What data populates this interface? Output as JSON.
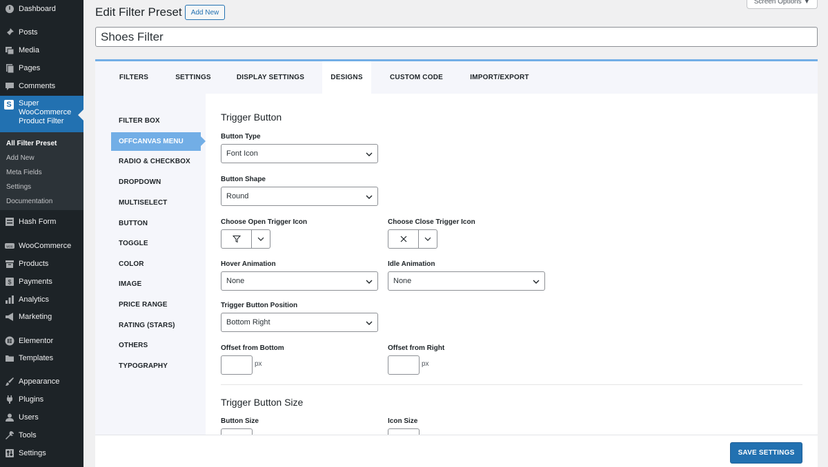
{
  "sidebar": {
    "items_top": [
      {
        "label": "Dashboard",
        "icon": "dashboard-icon"
      },
      {
        "label": "Posts",
        "icon": "pin-icon"
      },
      {
        "label": "Media",
        "icon": "media-icon"
      },
      {
        "label": "Pages",
        "icon": "page-icon"
      },
      {
        "label": "Comments",
        "icon": "comment-icon"
      }
    ],
    "current": {
      "label": "Super WooCommerce Product Filter",
      "icon_letter": "S"
    },
    "submenu": [
      "All Filter Preset",
      "Add New",
      "Meta Fields",
      "Settings",
      "Documentation"
    ],
    "items_bottom": [
      {
        "label": "Hash Form",
        "icon": "form-icon"
      },
      {
        "label": "WooCommerce",
        "icon": "woo-icon"
      },
      {
        "label": "Products",
        "icon": "archive-icon"
      },
      {
        "label": "Payments",
        "icon": "dollar-icon"
      },
      {
        "label": "Analytics",
        "icon": "bar-chart-icon"
      },
      {
        "label": "Marketing",
        "icon": "megaphone-icon"
      },
      {
        "label": "Elementor",
        "icon": "elementor-icon"
      },
      {
        "label": "Templates",
        "icon": "folder-icon"
      },
      {
        "label": "Appearance",
        "icon": "brush-icon"
      },
      {
        "label": "Plugins",
        "icon": "plugin-icon"
      },
      {
        "label": "Users",
        "icon": "user-icon"
      },
      {
        "label": "Tools",
        "icon": "wrench-icon"
      },
      {
        "label": "Settings",
        "icon": "settings-icon"
      }
    ]
  },
  "header": {
    "title": "Edit Filter Preset",
    "add_new": "Add New",
    "screen_options": "Screen Options ▼",
    "preset_title": "Shoes Filter"
  },
  "tabs": [
    "FILTERS",
    "SETTINGS",
    "DISPLAY SETTINGS",
    "DESIGNS",
    "CUSTOM CODE",
    "IMPORT/EXPORT"
  ],
  "active_tab": "DESIGNS",
  "left_nav": [
    "FILTER BOX",
    "OFFCANVAS MENU",
    "RADIO & CHECKBOX",
    "DROPDOWN",
    "MULTISELECT",
    "BUTTON",
    "TOGGLE",
    "COLOR",
    "IMAGE",
    "PRICE RANGE",
    "RATING (STARS)",
    "OTHERS",
    "TYPOGRAPHY"
  ],
  "active_nav": "OFFCANVAS MENU",
  "form": {
    "section1_title": "Trigger Button",
    "button_type_label": "Button Type",
    "button_type_value": "Font Icon",
    "button_shape_label": "Button Shape",
    "button_shape_value": "Round",
    "open_icon_label": "Choose Open Trigger Icon",
    "close_icon_label": "Choose Close Trigger Icon",
    "hover_label": "Hover Animation",
    "hover_value": "None",
    "idle_label": "Idle Animation",
    "idle_value": "None",
    "position_label": "Trigger Button Position",
    "position_value": "Bottom Right",
    "offset_bottom_label": "Offset from Bottom",
    "offset_right_label": "Offset from Right",
    "unit_px": "px",
    "section2_title": "Trigger Button Size",
    "button_size_label": "Button Size",
    "icon_size_label": "Icon Size"
  },
  "footer": {
    "save": "SAVE SETTINGS"
  },
  "colors": {
    "accent": "#2271b1",
    "highlight": "#72aee6",
    "sidebar": "#1d2327"
  }
}
